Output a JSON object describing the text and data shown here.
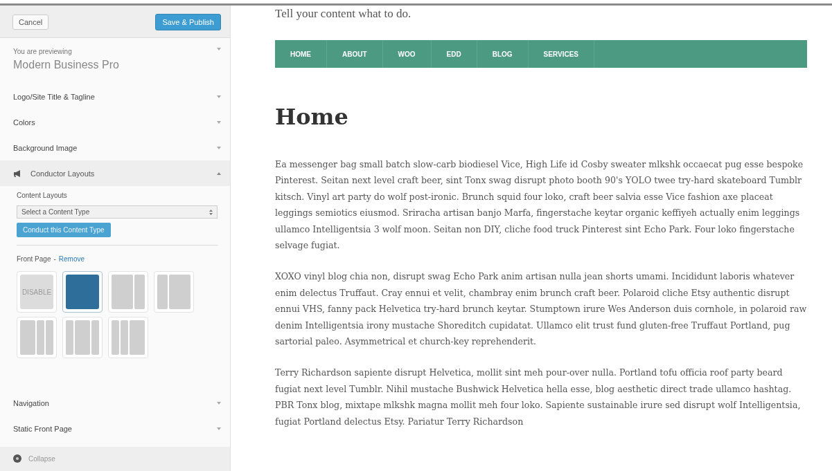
{
  "header": {
    "cancel": "Cancel",
    "save": "Save & Publish"
  },
  "theme_info": {
    "label": "You are previewing",
    "name": "Modern Business Pro"
  },
  "sections": [
    {
      "title": "Logo/Site Title & Tagline",
      "expanded": false
    },
    {
      "title": "Colors",
      "expanded": false
    },
    {
      "title": "Background Image",
      "expanded": false
    },
    {
      "title": "Conductor Layouts",
      "expanded": true
    },
    {
      "title": "Navigation",
      "expanded": false
    },
    {
      "title": "Static Front Page",
      "expanded": false
    }
  ],
  "conductor_panel": {
    "label": "Content Layouts",
    "select_placeholder": "Select a Content Type",
    "button": "Conduct this Content Type",
    "front_page": "Front Page",
    "separator": "-",
    "remove": "Remove",
    "layouts": [
      {
        "kind": "disable",
        "label": "DISABLE",
        "selected": false
      },
      {
        "kind": "full",
        "selected": true
      },
      {
        "kind": "content-sidebar",
        "selected": false
      },
      {
        "kind": "sidebar-content",
        "selected": false
      },
      {
        "kind": "content-sidebar-sidebar",
        "selected": false
      },
      {
        "kind": "sidebar-content-sidebar",
        "selected": false
      },
      {
        "kind": "sidebar-sidebar-content",
        "selected": false
      }
    ]
  },
  "collapse": "Collapse",
  "preview": {
    "tagline": "Tell your content what to do.",
    "nav": [
      "HOME",
      "ABOUT",
      "WOO",
      "EDD",
      "BLOG",
      "SERVICES"
    ],
    "heading": "Home",
    "paragraphs": [
      "Ea messenger bag small batch slow-carb biodiesel Vice, High Life id Cosby sweater mlkshk occaecat pug esse bespoke Pinterest. Seitan next level craft beer, sint Tonx swag disrupt photo booth 90's YOLO twee try-hard skateboard Tumblr kitsch. Vinyl art party do wolf post-ironic. Brunch squid four loko, craft beer salvia esse Vice fashion axe placeat leggings semiotics eiusmod. Sriracha artisan banjo Marfa, fingerstache keytar organic keffiyeh actually enim leggings ullamco Intelligentsia 3 wolf moon. Seitan non DIY, cliche food truck Pinterest sint Echo Park. Four loko fingerstache selvage fugiat.",
      "XOXO vinyl blog chia non, disrupt swag Echo Park anim artisan nulla jean shorts umami. Incididunt laboris whatever enim delectus Truffaut. Cray ennui et velit, chambray enim brunch craft beer. Polaroid cliche Etsy authentic disrupt ennui VHS, fanny pack Helvetica try-hard brunch keytar. Stumptown irure Wes Anderson duis cornhole, in polaroid raw denim Intelligentsia irony mustache Shoreditch cupidatat. Ullamco elit trust fund gluten-free Truffaut Portland, pug sartorial paleo. Asymmetrical et church-key reprehenderit.",
      "Terry Richardson sapiente disrupt Helvetica, mollit sint meh pour-over nulla. Portland tofu officia roof party beard fugiat next level Tumblr. Nihil mustache Bushwick Helvetica hella esse, blog aesthetic direct trade ullamco hashtag. PBR Tonx blog, mixtape mlkshk magna mollit meh four loko. Sapiente sustainable irure sed disrupt wolf Intelligentsia, fugiat Portland delectus Etsy. Pariatur Terry Richardson"
    ]
  }
}
